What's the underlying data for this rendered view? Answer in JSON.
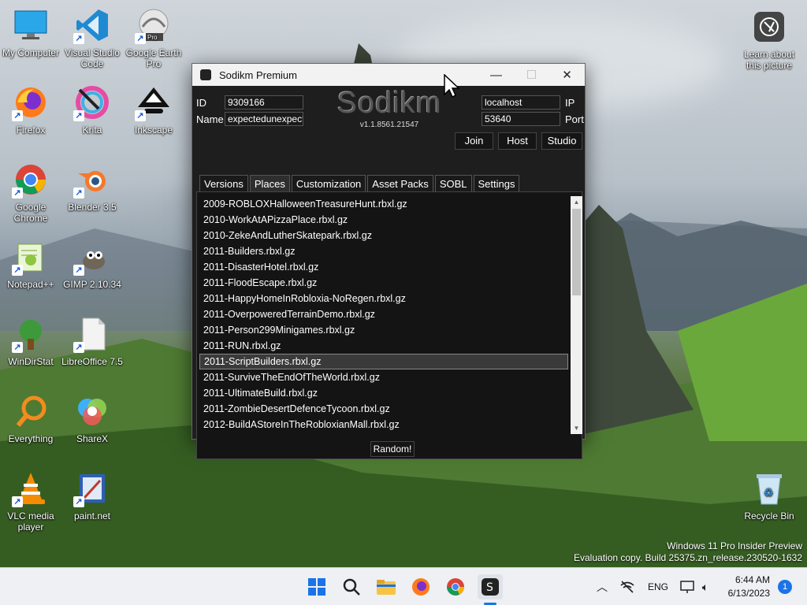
{
  "desktop": {
    "icons": [
      {
        "label": "My Computer",
        "icon": "monitor-icon"
      },
      {
        "label": "Visual Studio Code",
        "icon": "vscode-icon"
      },
      {
        "label": "Google Earth Pro",
        "icon": "google-earth-icon"
      },
      {
        "label": "Firefox",
        "icon": "firefox-icon"
      },
      {
        "label": "Krita",
        "icon": "krita-icon"
      },
      {
        "label": "Inkscape",
        "icon": "inkscape-icon"
      },
      {
        "label": "Google Chrome",
        "icon": "chrome-icon"
      },
      {
        "label": "Blender 3.5",
        "icon": "blender-icon"
      },
      {
        "label": "Notepad++",
        "icon": "notepadpp-icon"
      },
      {
        "label": "GIMP 2.10.34",
        "icon": "gimp-icon"
      },
      {
        "label": "WinDirStat",
        "icon": "windirstat-icon"
      },
      {
        "label": "LibreOffice 7.5",
        "icon": "libreoffice-icon"
      },
      {
        "label": "Everything",
        "icon": "everything-icon"
      },
      {
        "label": "ShareX",
        "icon": "sharex-icon"
      },
      {
        "label": "VLC media player",
        "icon": "vlc-icon"
      },
      {
        "label": "paint.net",
        "icon": "paintnet-icon"
      }
    ],
    "learn_label": "Learn about this picture",
    "recycle_label": "Recycle Bin",
    "watermark_line1": "Windows 11 Pro Insider Preview",
    "watermark_line2": "Evaluation copy. Build 25375.zn_release.230520-1632"
  },
  "window": {
    "title": "Sodikm Premium",
    "id_label": "ID",
    "id_value": "9309166",
    "name_label": "Name",
    "name_value": "expectedunexpect",
    "logo": "Sodikm",
    "version": "v1.1.8561.21547",
    "ip_value": "localhost",
    "ip_label": "IP",
    "port_value": "53640",
    "port_label": "Port",
    "join_label": "Join",
    "host_label": "Host",
    "studio_label": "Studio",
    "tabs": [
      "Versions",
      "Places",
      "Customization",
      "Asset Packs",
      "SOBL",
      "Settings"
    ],
    "active_tab": "Places",
    "places": [
      "2009-ROBLOXHalloweenTreasureHunt.rbxl.gz",
      "2010-WorkAtAPizzaPlace.rbxl.gz",
      "2010-ZekeAndLutherSkatepark.rbxl.gz",
      "2011-Builders.rbxl.gz",
      "2011-DisasterHotel.rbxl.gz",
      "2011-FloodEscape.rbxl.gz",
      "2011-HappyHomeInRobloxia-NoRegen.rbxl.gz",
      "2011-OverpoweredTerrainDemo.rbxl.gz",
      "2011-Person299Minigames.rbxl.gz",
      "2011-RUN.rbxl.gz",
      "2011-ScriptBuilders.rbxl.gz",
      "2011-SurviveTheEndOfTheWorld.rbxl.gz",
      "2011-UltimateBuild.rbxl.gz",
      "2011-ZombieDesertDefenceTycoon.rbxl.gz",
      "2012-BuildAStoreInTheRobloxianMall.rbxl.gz"
    ],
    "selected_place": "2011-ScriptBuilders.rbxl.gz",
    "random_label": "Random!"
  },
  "taskbar": {
    "lang": "ENG",
    "time": "6:44 AM",
    "date": "6/13/2023",
    "notification_count": "1"
  }
}
